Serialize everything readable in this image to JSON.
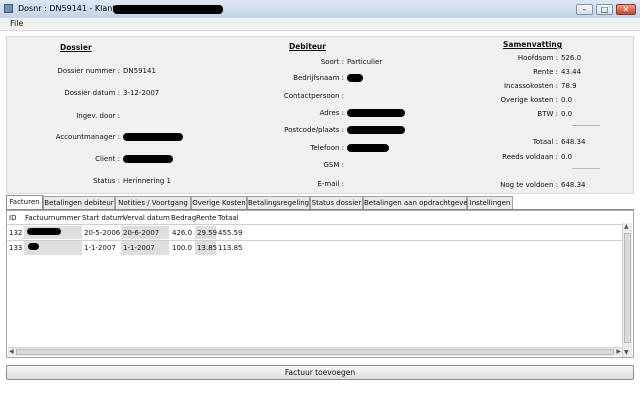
{
  "window": {
    "title": "Dosnr : DN59141 - Klant :"
  },
  "menu": {
    "file": "File"
  },
  "dossier": {
    "heading": "Dossier",
    "fields": [
      {
        "label": "Dossier nummer :",
        "value": "DN59141"
      },
      {
        "label": "Dossier datum :",
        "value": "3-12-2007"
      },
      {
        "label": "Ingev. door :",
        "value": ""
      },
      {
        "label": "Accountmanager :",
        "value": ""
      },
      {
        "label": "Client :",
        "value": ""
      },
      {
        "label": "Status :",
        "value": "Herinnering 1"
      }
    ]
  },
  "debiteur": {
    "heading": "Debiteur",
    "fields": [
      {
        "label": "Soort :",
        "value": "Particulier"
      },
      {
        "label": "Bedrijfsnaam :",
        "value": ""
      },
      {
        "label": "Contactpersoon :",
        "value": ""
      },
      {
        "label": "Adres :",
        "value": ""
      },
      {
        "label": "Postcode/plaats :",
        "value": ""
      },
      {
        "label": "Telefoon :",
        "value": ""
      },
      {
        "label": "GSM :",
        "value": ""
      },
      {
        "label": "E-mail :",
        "value": ""
      }
    ]
  },
  "samenvatting": {
    "heading": "Samenvatting",
    "fields": [
      {
        "label": "Hoofdsom :",
        "value": "526.0"
      },
      {
        "label": "Rente :",
        "value": "43.44"
      },
      {
        "label": "Incassokosten :",
        "value": "78.9"
      },
      {
        "label": "Overige kosten :",
        "value": "0.0"
      },
      {
        "label": "BTW :",
        "value": "0.0"
      },
      {
        "label": "Totaal :",
        "value": "648.34"
      },
      {
        "label": "Reeds voldaan :",
        "value": "0.0"
      },
      {
        "label": "Nog te voldoen :",
        "value": "648.34"
      }
    ]
  },
  "tabs": [
    "Facturen",
    "Betalingen debiteur",
    "Notities / Voortgang",
    "Overige Kosten",
    "Betalingsregeling",
    "Status dossier",
    "Betalingen aan opdrachtgever",
    "Instellingen"
  ],
  "table": {
    "columns": [
      "ID",
      "Factuurnummer",
      "Start datum",
      "Verval datum",
      "Bedrag",
      "Rente",
      "Totaal"
    ],
    "rows": [
      [
        "132",
        "",
        "20-5-2006",
        "20-6-2007",
        "426.0",
        "29.59",
        "455.59"
      ],
      [
        "133",
        "",
        "1-1-2007",
        "1-1-2007",
        "100.0",
        "13.85",
        "113.85"
      ]
    ]
  },
  "button": {
    "add_invoice": "Factuur toevoegen"
  },
  "icons": {
    "minimize": "minimize-icon",
    "maximize": "maximize-icon",
    "close": "close-icon"
  }
}
